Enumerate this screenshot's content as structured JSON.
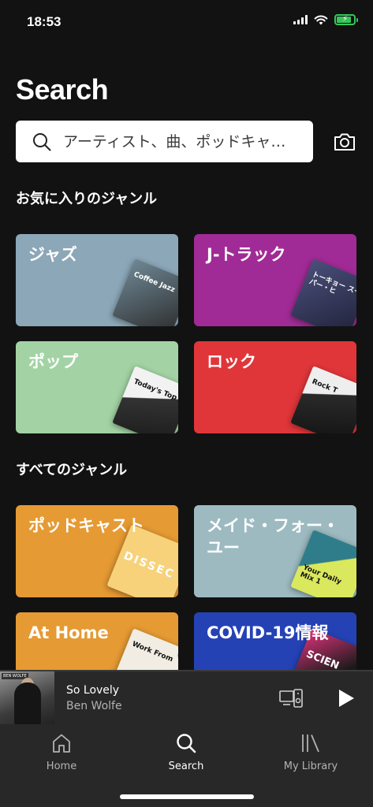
{
  "status_bar": {
    "time": "18:53"
  },
  "header": {
    "title": "Search"
  },
  "search": {
    "placeholder": "アーティスト、曲、ポッドキャ…"
  },
  "sections": {
    "favorites": "お気に入りのジャンル",
    "all": "すべてのジャンル"
  },
  "cards": {
    "jazz": {
      "label": "ジャズ",
      "art_text": "Coffee Jazz"
    },
    "jtrack": {
      "label": "J-トラック",
      "art_text": "トーキョー スーパー・ヒ"
    },
    "pop": {
      "label": "ポップ",
      "art_text": "Today's Top Hi"
    },
    "rock": {
      "label": "ロック",
      "art_text": "Rock T"
    },
    "podcast": {
      "label": "ポッドキャスト",
      "art_text": "DISSEC"
    },
    "madefor": {
      "label": "メイド・フォー・ユー",
      "art_text": "Your Daily Mix 1"
    },
    "athome": {
      "label": "At Home",
      "art_text": "Work From"
    },
    "covid": {
      "label": "COVID-19情報",
      "art_text": "SCIEN"
    }
  },
  "player": {
    "song": "So Lovely",
    "artist": "Ben Wolfe",
    "thumb_tag": "BEN WOLFE"
  },
  "nav": {
    "home": "Home",
    "search": "Search",
    "library": "My Library"
  },
  "colors": {
    "background": "#121212",
    "jazz": "#8ba7b8",
    "jtrack": "#a12b96",
    "pop": "#a3d3a4",
    "rock": "#e0363a",
    "podcast": "#e59a33",
    "madefor": "#9dbac1",
    "athome": "#e59a33",
    "covid": "#2542b5"
  }
}
